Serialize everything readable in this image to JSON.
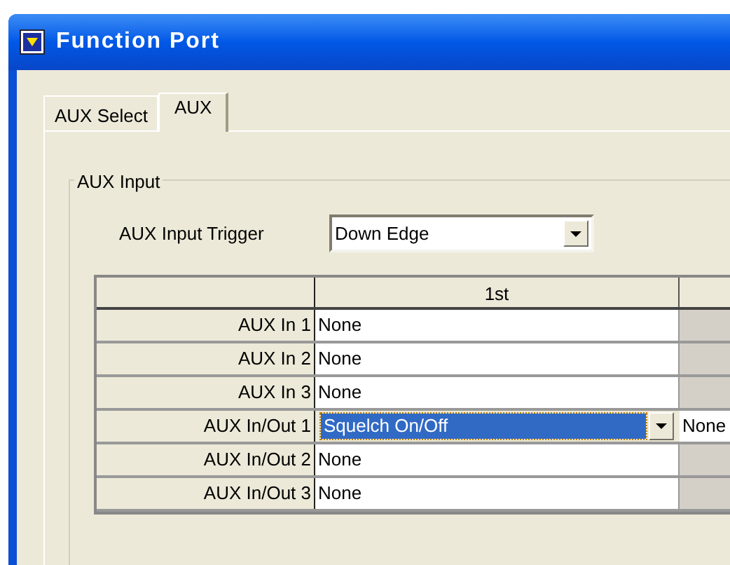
{
  "window": {
    "title": "Function Port"
  },
  "tabs": [
    {
      "label": "AUX Select",
      "selected": false
    },
    {
      "label": "AUX",
      "selected": true
    }
  ],
  "group": {
    "title": "AUX Input",
    "trigger": {
      "label": "AUX Input Trigger",
      "value": "Down Edge"
    }
  },
  "table": {
    "columns": [
      "1st"
    ],
    "rows": [
      {
        "label": "AUX In 1",
        "value": "None",
        "kind": "text",
        "selected": false
      },
      {
        "label": "AUX In 2",
        "value": "None",
        "kind": "text",
        "selected": false
      },
      {
        "label": "AUX In 3",
        "value": "None",
        "kind": "text",
        "selected": false
      },
      {
        "label": "AUX In/Out 1",
        "value": "Squelch On/Off",
        "kind": "dropdown",
        "selected": true,
        "column_2": "None"
      },
      {
        "label": "AUX In/Out 2",
        "value": "None",
        "kind": "text",
        "selected": false
      },
      {
        "label": "AUX In/Out 3",
        "value": "None",
        "kind": "text",
        "selected": false
      }
    ]
  }
}
